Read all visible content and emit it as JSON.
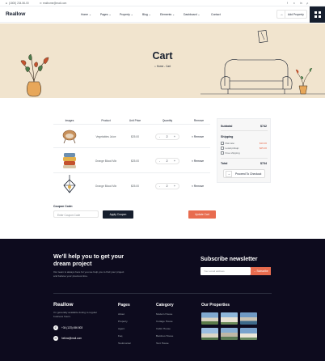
{
  "topbar": {
    "phone": "(1800) 234-56-00",
    "email": "realhome@mail.com",
    "social": [
      "f",
      "x",
      "in",
      "yt"
    ]
  },
  "header": {
    "logo": "Reallow",
    "nav": [
      {
        "label": "Home",
        "caret": "⌄"
      },
      {
        "label": "Pages",
        "caret": "⌄"
      },
      {
        "label": "Property",
        "caret": "⌄"
      },
      {
        "label": "Blog",
        "caret": "⌄"
      },
      {
        "label": "Elements",
        "caret": "⌄"
      },
      {
        "label": "Dashboard",
        "caret": "⌄"
      },
      {
        "label": "Contact",
        "caret": ""
      }
    ],
    "add_property": "Add Property"
  },
  "hero": {
    "title": "Cart",
    "breadcrumb_home": "Home",
    "breadcrumb_sep": "-",
    "breadcrumb_current": "Cart"
  },
  "cart": {
    "headers": [
      "Images",
      "Product",
      "Unit Price",
      "Quantity",
      "Remove"
    ],
    "items": [
      {
        "product": "Vegetables Juice",
        "price": "$25.00",
        "qty": "2",
        "remove": "Remove",
        "image": "wicker-chair-icon"
      },
      {
        "product": "Orange Blood Mix",
        "price": "$25.00",
        "qty": "2",
        "remove": "Remove",
        "image": "pillows-icon"
      },
      {
        "product": "Orange Blood Mix",
        "price": "$25.00",
        "qty": "2",
        "remove": "Remove",
        "image": "pendant-lamp-icon"
      }
    ],
    "minus": "-",
    "plus": "+",
    "remove_x": "×"
  },
  "summary": {
    "subtotal_label": "Subtotal",
    "subtotal_value": "$742",
    "shipping_label": "Shipping",
    "options": [
      {
        "label": "Flat rate:",
        "value": "$10.00"
      },
      {
        "label": "Local pickup:",
        "value": "$25.00"
      },
      {
        "label": "Free shipping",
        "value": ""
      }
    ],
    "total_label": "Total",
    "total_value": "$734",
    "checkout": "Proceed To Checkout"
  },
  "coupon": {
    "label": "Coupon Code:",
    "placeholder": "Enter Coupon Code",
    "apply": "Apply Coupon",
    "update": "Update Cart"
  },
  "footer": {
    "help_title": "We'll help you to get your dream project",
    "help_sub": "Our team is always here for you we help you to find your project and believe your previous time.",
    "newsletter_title": "Subscribe newsletter",
    "email_placeholder": "Your email address",
    "subscribe": "Subscribe",
    "logo": "Reallow",
    "desc": "I'm generally available during to regular business hours.",
    "phone": "+34 (123) 456 803",
    "email": "hellow@mail.com",
    "pages_title": "Pages",
    "pages": [
      "About",
      "Property",
      "Agent",
      "Faq",
      "Testimonial"
    ],
    "category_title": "Category",
    "categories": [
      "Modern House",
      "Cottage House",
      "Cabin House",
      "Bamboo House",
      "Tent House"
    ],
    "properties_title": "Our Properties"
  },
  "colors": {
    "accent": "#e86c4f",
    "dark": "#161e2d",
    "hero_bg": "#f1e4ce",
    "footer_bg": "#0d0b1e"
  }
}
